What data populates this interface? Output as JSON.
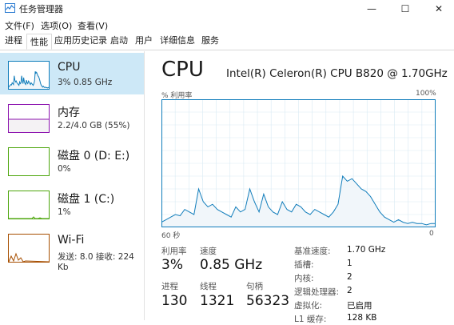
{
  "window": {
    "title": "任务管理器",
    "minimize": "—",
    "maximize": "☐",
    "close": "✕"
  },
  "menu": [
    "文件(F)",
    "选项(O)",
    "查看(V)"
  ],
  "tabs": [
    "进程",
    "性能",
    "应用历史记录",
    "启动",
    "用户",
    "详细信息",
    "服务"
  ],
  "active_tab": "性能",
  "resources": [
    {
      "name": "CPU",
      "value": "3% 0.85 GHz",
      "color": "#117dbb",
      "fill": "#f1f6fa",
      "selected": true
    },
    {
      "name": "内存",
      "value": "2.2/4.0 GB (55%)",
      "color": "#8b12ae",
      "fill": "#f4f2f4",
      "selected": false
    },
    {
      "name": "磁盘 0 (D: E:)",
      "value": "0%",
      "color": "#4da60c",
      "fill": "#eff7ea",
      "selected": false
    },
    {
      "name": "磁盘 1 (C:)",
      "value": "1%",
      "color": "#4da60c",
      "fill": "#eff7ea",
      "selected": false
    },
    {
      "name": "Wi-Fi",
      "value": "发送: 8.0 接收: 224 Kb",
      "color": "#a74f01",
      "fill": "#fcf3eb",
      "selected": false
    }
  ],
  "detail": {
    "title": "CPU",
    "model": "Intel(R) Celeron(R) CPU B820 @ 1.70GHz",
    "graph_ylabel": "% 利用率",
    "graph_ymax": "100%",
    "graph_xleft": "60 秒",
    "graph_xright": "0",
    "graph_color": "#117dbb",
    "graph_fill": "#f1f6fa",
    "utilization_history": [
      4,
      6,
      8,
      10,
      9,
      14,
      12,
      10,
      30,
      20,
      16,
      18,
      14,
      12,
      10,
      8,
      16,
      12,
      14,
      30,
      20,
      12,
      26,
      16,
      12,
      10,
      20,
      14,
      12,
      18,
      16,
      12,
      10,
      14,
      12,
      10,
      8,
      12,
      18,
      40,
      36,
      38,
      34,
      30,
      28,
      24,
      18,
      12,
      8,
      6,
      4,
      6,
      4,
      3,
      4,
      3,
      3,
      2,
      3,
      3
    ],
    "stats": [
      {
        "label": "利用率",
        "value": "3%"
      },
      {
        "label": "速度",
        "value": "0.85 GHz"
      },
      {
        "label": "进程",
        "value": "130"
      },
      {
        "label": "线程",
        "value": "1321"
      },
      {
        "label": "句柄",
        "value": "56323"
      }
    ],
    "info": [
      {
        "label": "基准速度:",
        "value": "1.70 GHz"
      },
      {
        "label": "插槽:",
        "value": "1"
      },
      {
        "label": "内核:",
        "value": "2"
      },
      {
        "label": "逻辑处理器:",
        "value": "2"
      },
      {
        "label": "虚拟化:",
        "value": "已启用"
      },
      {
        "label": "L1 缓存:",
        "value": "128 KB"
      }
    ]
  },
  "icons": {
    "app": "task-manager-icon"
  }
}
